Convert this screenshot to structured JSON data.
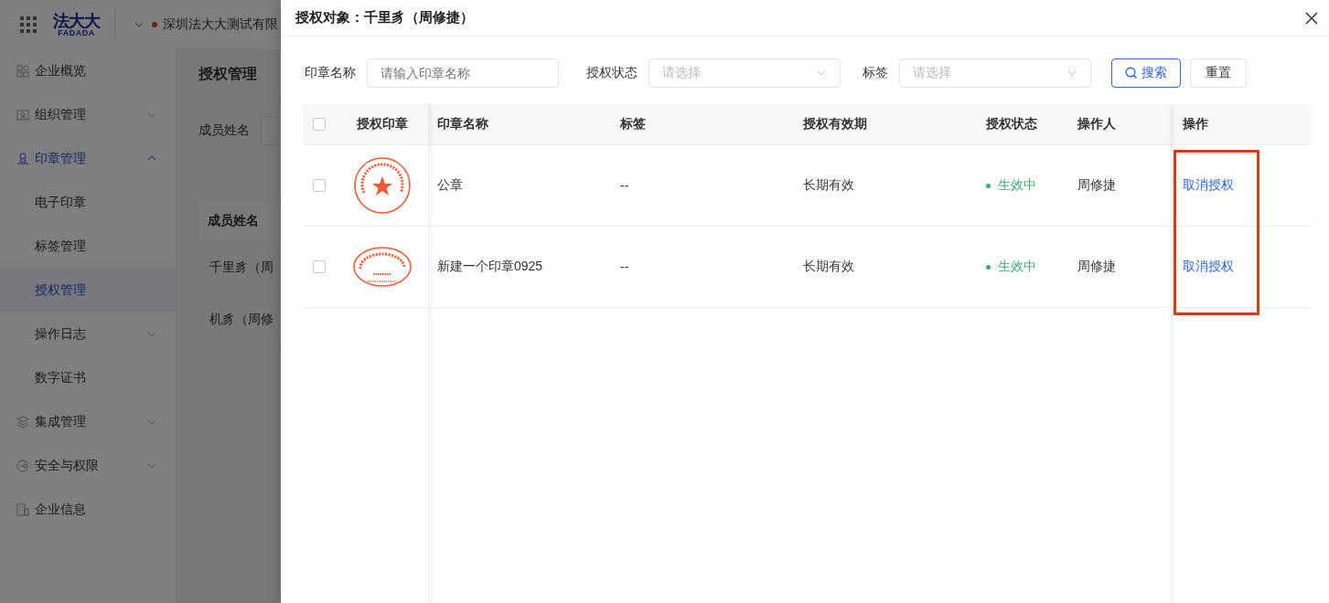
{
  "topbar": {
    "logo": {
      "text": "法大大",
      "subtext": "FADADA"
    },
    "company": "深圳法大大测试有限"
  },
  "sidebar": {
    "items": [
      {
        "label": "企业概览",
        "selected": false
      },
      {
        "label": "组织管理",
        "selected": false,
        "expanded": false
      },
      {
        "label": "印章管理",
        "selected": true,
        "expanded": true,
        "children": [
          {
            "label": "电子印章",
            "selected": false
          },
          {
            "label": "标签管理",
            "selected": false
          },
          {
            "label": "授权管理",
            "selected": true
          },
          {
            "label": "操作日志",
            "selected": false,
            "expanded": false
          },
          {
            "label": "数字证书",
            "selected": false
          }
        ]
      },
      {
        "label": "集成管理",
        "selected": false,
        "expanded": false
      },
      {
        "label": "安全与权限",
        "selected": false,
        "expanded": false
      },
      {
        "label": "企业信息",
        "selected": false
      }
    ]
  },
  "page": {
    "title": "授权管理",
    "filter_label": "成员姓名",
    "table": {
      "columns": [
        "成员姓名"
      ],
      "rows": [
        "千里豸（周",
        "机豸（周修"
      ]
    }
  },
  "drawer": {
    "title": "授权对象：千里豸（周修捷）",
    "filters": [
      {
        "kind": "input",
        "label": "印章名称",
        "placeholder": "请输入印章名称"
      },
      {
        "kind": "select",
        "label": "授权状态",
        "placeholder": "请选择"
      },
      {
        "kind": "select",
        "label": "标签",
        "placeholder": "请选择"
      }
    ],
    "buttons": [
      {
        "kind": "primary",
        "label": "搜索"
      },
      {
        "kind": "default",
        "label": "重置"
      }
    ],
    "table": {
      "select_all": {
        "checked": false
      },
      "columns": [
        "授权印章",
        "印章名称",
        "标签",
        "授权有效期",
        "授权状态",
        "操作人",
        "操作"
      ],
      "rows": [
        {
          "checked": false,
          "seal": {
            "kind": "round"
          },
          "name": "公章",
          "tag": "--",
          "validity": "长期有效",
          "status": "生效中",
          "operator": "周修捷",
          "action": "取消授权"
        },
        {
          "checked": false,
          "seal": {
            "kind": "oval"
          },
          "name": "新建一个印章0925",
          "tag": "--",
          "validity": "长期有效",
          "status": "生效中",
          "operator": "周修捷",
          "action": "取消授权"
        }
      ]
    }
  }
}
